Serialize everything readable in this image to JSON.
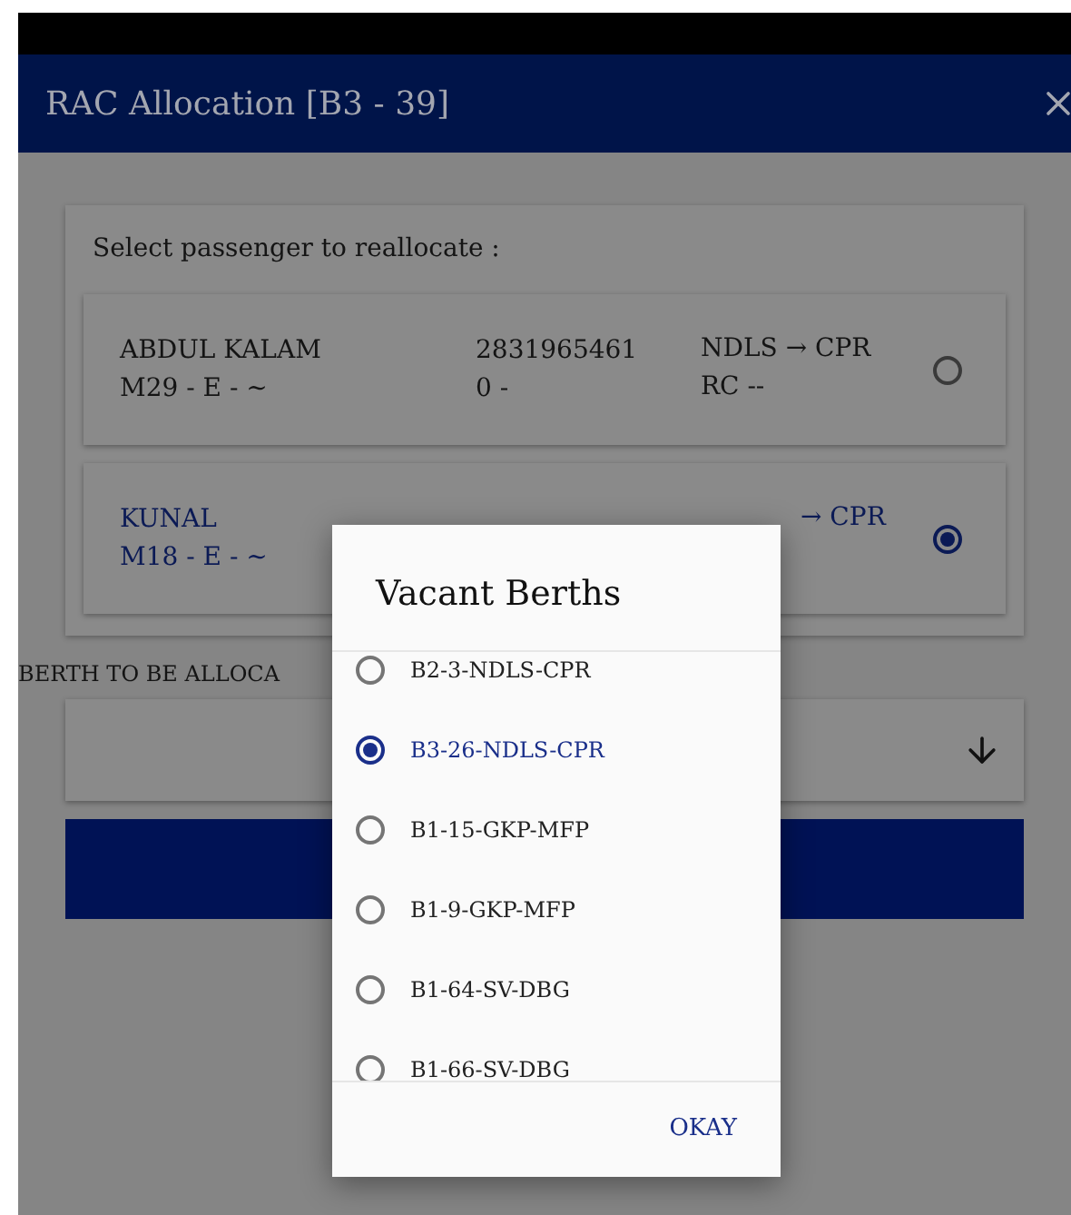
{
  "window": {
    "title": "RAC Allocation [B3 - 39]"
  },
  "passenger_panel": {
    "heading": "Select passenger to reallocate :",
    "passengers": [
      {
        "name": "ABDUL KALAM",
        "detail": "M29 - E - ~",
        "pnr": "2831965461",
        "pnr_sub": "0 -",
        "route": "NDLS → CPR",
        "status": "RC --",
        "selected": false
      },
      {
        "name": "KUNAL",
        "detail": "M18 - E - ~",
        "route": "→ CPR",
        "selected": true
      }
    ]
  },
  "berth_field": {
    "label": "BERTH TO BE ALLOCA"
  },
  "dialog": {
    "title": "Vacant Berths",
    "options": [
      {
        "label": "B2-3-NDLS-CPR",
        "selected": false
      },
      {
        "label": "B3-26-NDLS-CPR",
        "selected": true
      },
      {
        "label": "B1-15-GKP-MFP",
        "selected": false
      },
      {
        "label": "B1-9-GKP-MFP",
        "selected": false
      },
      {
        "label": "B1-64-SV-DBG",
        "selected": false
      },
      {
        "label": "B1-66-SV-DBG",
        "selected": false
      }
    ],
    "button": "OKAY"
  }
}
